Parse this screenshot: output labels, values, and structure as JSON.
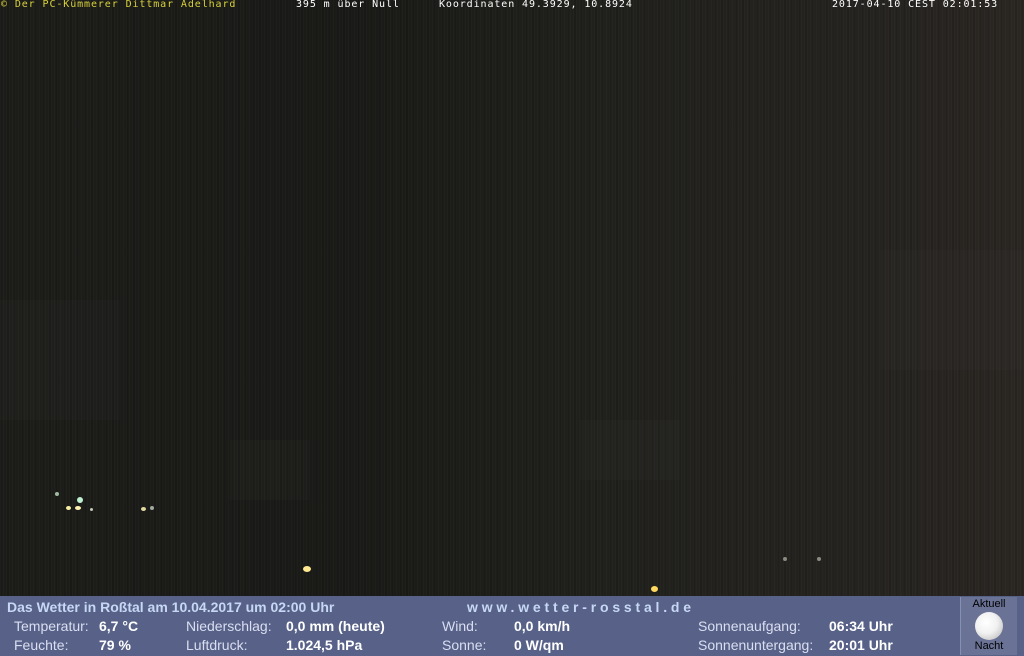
{
  "overlay": {
    "copyright": "© Der PC-Kümmerer Dittmar Adelhard",
    "altitude": "395 m über Null",
    "coordinates": "Koordinaten 49.3929, 10.8924",
    "timestamp": "2017-04-10 CEST 02:01:53"
  },
  "weather": {
    "title": "Das Wetter in Roßtal am 10.04.2017 um 02:00 Uhr",
    "website": "www.wetter-rosstal.de",
    "temperature": {
      "label": "Temperatur:",
      "value": "6,7 °C"
    },
    "humidity": {
      "label": "Feuchte:",
      "value": "79 %"
    },
    "precipitation": {
      "label": "Niederschlag:",
      "value": "0,0 mm (heute)"
    },
    "pressure": {
      "label": "Luftdruck:",
      "value": "1.024,5 hPa"
    },
    "wind": {
      "label": "Wind:",
      "value": "0,0 km/h"
    },
    "sun": {
      "label": "Sonne:",
      "value": "0 W/qm"
    },
    "sunrise": {
      "label": "Sonnenaufgang:",
      "value": "06:34 Uhr"
    },
    "sunset": {
      "label": "Sonnenuntergang:",
      "value": "20:01 Uhr"
    }
  },
  "moon": {
    "top": "Aktuell",
    "bottom": "Nacht",
    "icon": "moon-icon"
  },
  "colors": {
    "panel": "#586289",
    "header_text": "#c8d7f4",
    "copyright_text": "#d8d23a"
  }
}
